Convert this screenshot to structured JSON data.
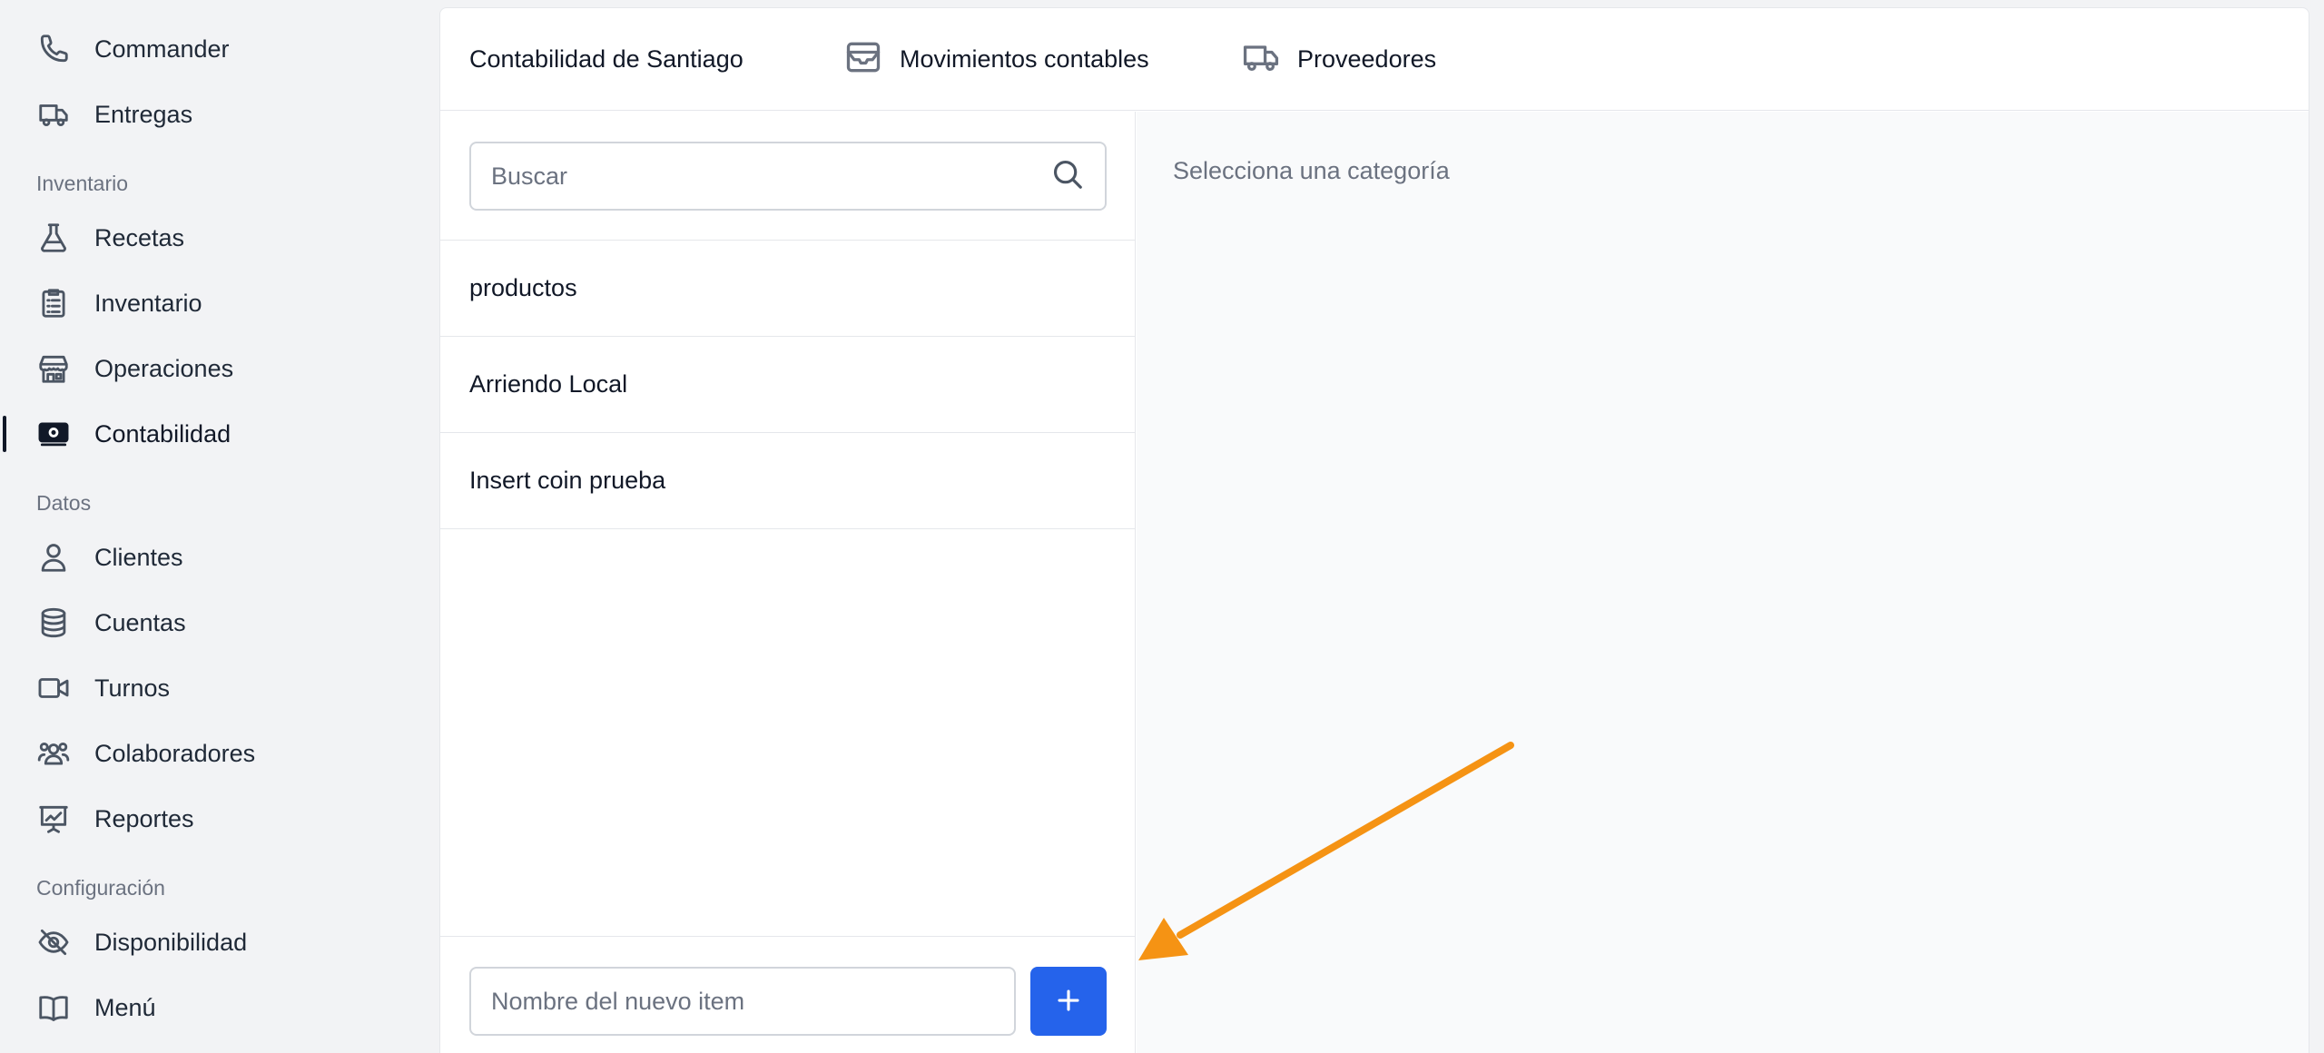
{
  "sidebar": {
    "top_items": [
      {
        "label": "Commander",
        "icon": "phone-icon"
      },
      {
        "label": "Entregas",
        "icon": "truck-icon"
      }
    ],
    "sections": [
      {
        "title": "Inventario",
        "items": [
          {
            "label": "Recetas",
            "icon": "flask-icon"
          },
          {
            "label": "Inventario",
            "icon": "clipboard-icon"
          },
          {
            "label": "Operaciones",
            "icon": "store-icon"
          },
          {
            "label": "Contabilidad",
            "icon": "money-icon",
            "active": true
          }
        ]
      },
      {
        "title": "Datos",
        "items": [
          {
            "label": "Clientes",
            "icon": "user-icon"
          },
          {
            "label": "Cuentas",
            "icon": "database-icon"
          },
          {
            "label": "Turnos",
            "icon": "video-icon"
          },
          {
            "label": "Colaboradores",
            "icon": "users-icon"
          },
          {
            "label": "Reportes",
            "icon": "chart-icon"
          }
        ]
      },
      {
        "title": "Configuración",
        "items": [
          {
            "label": "Disponibilidad",
            "icon": "eye-slash-icon"
          },
          {
            "label": "Menú",
            "icon": "book-icon"
          }
        ]
      }
    ]
  },
  "tabs": [
    {
      "label": "Contabilidad de Santiago",
      "icon": ""
    },
    {
      "label": "Movimientos contables",
      "icon": "inbox-icon"
    },
    {
      "label": "Proveedores",
      "icon": "truck-icon"
    }
  ],
  "search": {
    "placeholder": "Buscar",
    "value": ""
  },
  "categories": [
    "productos",
    "Arriendo Local",
    "Insert coin prueba"
  ],
  "new_item": {
    "placeholder": "Nombre del nuevo item",
    "value": "",
    "button_label": "+"
  },
  "detail": {
    "placeholder": "Selecciona una categoría"
  },
  "colors": {
    "accent": "#2563eb",
    "annotation_arrow": "#f59314",
    "active_bar": "#111827"
  }
}
